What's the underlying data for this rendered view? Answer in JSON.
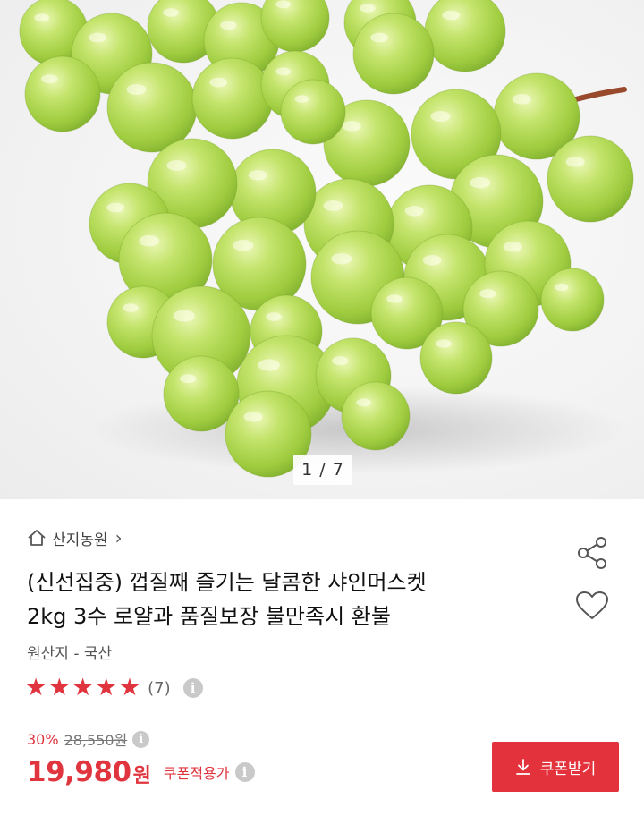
{
  "gallery": {
    "counter": "1 / 7",
    "image_alt": "green shine muscat grapes"
  },
  "seller": {
    "icon": "home-icon",
    "name": "산지농원",
    "chevron": "›"
  },
  "product": {
    "title_line1": "(신선집중) 껍질째 즐기는 달콤한 샤인머스켓",
    "title_line2": "2kg 3수 로얄과 품질보장 불만족시 환불",
    "origin": "원산지 - 국산"
  },
  "actions": {
    "share_icon": "share-icon",
    "wishlist_icon": "heart-icon"
  },
  "rating": {
    "stars": 5,
    "max_stars": 5,
    "review_count": "(7)",
    "info": "i"
  },
  "price": {
    "discount": "30%",
    "original": "28,550원",
    "current": "19,980",
    "currency": "원",
    "coupon_note": "쿠폰적용가",
    "info": "i"
  },
  "coupon_button": {
    "label": "쿠폰받기",
    "icon": "download-icon"
  },
  "colors": {
    "accent": "#e3323c",
    "star": "#e0343f",
    "grape": "#b6dc5a"
  }
}
